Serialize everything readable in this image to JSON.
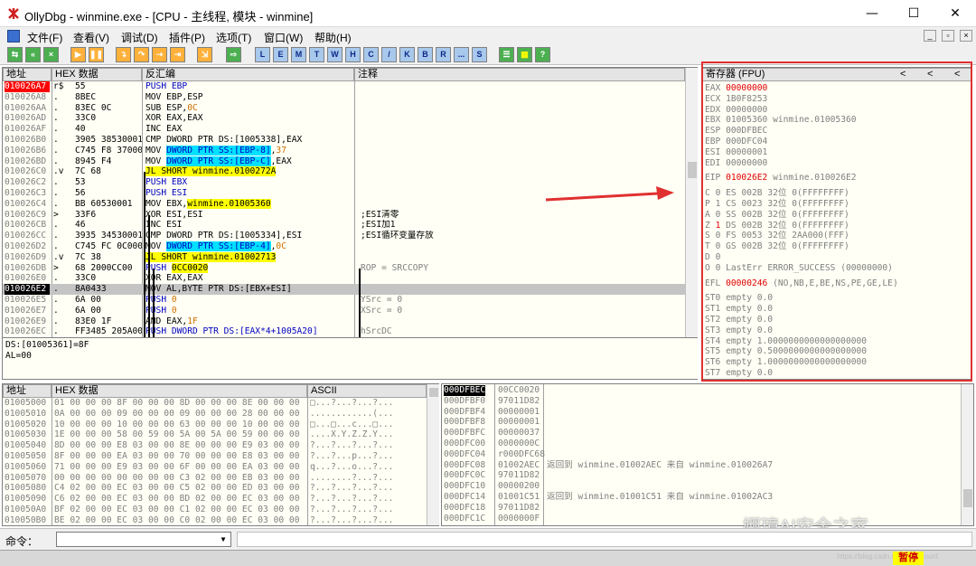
{
  "window": {
    "title": "OllyDbg - winmine.exe - [CPU - 主线程, 模块 - winmine]",
    "min": "—",
    "max": "☐",
    "close": "✕"
  },
  "menu": [
    "文件(F)",
    "查看(V)",
    "调试(D)",
    "插件(P)",
    "选项(T)",
    "窗口(W)",
    "帮助(H)"
  ],
  "toolbar_letters": [
    "L",
    "E",
    "M",
    "T",
    "W",
    "H",
    "C",
    "/",
    "K",
    "B",
    "R",
    "...",
    "S"
  ],
  "disasm": {
    "headers": [
      "地址",
      "HEX 数据",
      "反汇编",
      "注释"
    ],
    "rows": [
      {
        "addr": "010026A7",
        "mark": "r$",
        "hex": "55",
        "asm": [
          [
            "PUSH EBP",
            "blue"
          ]
        ],
        "cmt": "",
        "sel": "addr"
      },
      {
        "addr": "010026A8",
        "mark": ".",
        "hex": "8BEC",
        "asm": [
          [
            "MOV EBP,ESP",
            ""
          ]
        ],
        "cmt": ""
      },
      {
        "addr": "010026AA",
        "mark": ".",
        "hex": "83EC 0C",
        "asm": [
          [
            "SUB ESP,",
            ""
          ],
          [
            "0C",
            "orange"
          ]
        ],
        "cmt": ""
      },
      {
        "addr": "010026AD",
        "mark": ".",
        "hex": "33C0",
        "asm": [
          [
            "XOR EAX,EAX",
            ""
          ]
        ],
        "cmt": ""
      },
      {
        "addr": "010026AF",
        "mark": ".",
        "hex": "40",
        "asm": [
          [
            "INC EAX",
            ""
          ]
        ],
        "cmt": ""
      },
      {
        "addr": "010026B0",
        "mark": ".",
        "hex": "3905 38530001",
        "asm": [
          [
            "CMP DWORD PTR DS:[1005338],EAX",
            ""
          ]
        ],
        "cmt": ""
      },
      {
        "addr": "010026B6",
        "mark": ".",
        "hex": "C745 F8 370000",
        "asm": [
          [
            "MOV ",
            ""
          ],
          [
            "DWORD PTR SS:[EBP-8]",
            "hlcyan"
          ],
          [
            ",",
            ""
          ],
          [
            "37",
            "orange"
          ]
        ],
        "cmt": ""
      },
      {
        "addr": "010026BD",
        "mark": ".",
        "hex": "8945 F4",
        "asm": [
          [
            "MOV ",
            ""
          ],
          [
            "DWORD PTR SS:[EBP-C]",
            "hlcyan"
          ],
          [
            ",EAX",
            ""
          ]
        ],
        "cmt": ""
      },
      {
        "addr": "010026C0",
        "mark": ".v",
        "hex": "7C 68",
        "asm": [
          [
            "JL SHORT winmine.0100272A",
            "hlyel"
          ]
        ],
        "cmt": ""
      },
      {
        "addr": "010026C2",
        "mark": ".",
        "hex": "53",
        "asm": [
          [
            "PUSH EBX",
            "blue"
          ]
        ],
        "cmt": ""
      },
      {
        "addr": "010026C3",
        "mark": ".",
        "hex": "56",
        "asm": [
          [
            "PUSH ESI",
            "blue"
          ]
        ],
        "cmt": ""
      },
      {
        "addr": "010026C4",
        "mark": ".",
        "hex": "BB 60530001",
        "asm": [
          [
            "MOV EBX,",
            ""
          ],
          [
            "winmine.01005360",
            "hlyel"
          ]
        ],
        "cmt": ""
      },
      {
        "addr": "010026C9",
        "mark": ">",
        "hex": "33F6",
        "asm": [
          [
            "XOR ESI,ESI",
            ""
          ]
        ],
        "cmt": ";ESI清零"
      },
      {
        "addr": "010026CB",
        "mark": ".",
        "hex": "46",
        "asm": [
          [
            "INC ESI",
            ""
          ]
        ],
        "cmt": ";ESI加1"
      },
      {
        "addr": "010026CC",
        "mark": ".",
        "hex": "3935 34530001",
        "asm": [
          [
            "CMP DWORD PTR DS:[1005334],ESI",
            ""
          ]
        ],
        "cmt": ";ESI循环变量存放"
      },
      {
        "addr": "010026D2",
        "mark": ".",
        "hex": "C745 FC 0C0000",
        "asm": [
          [
            "MOV ",
            ""
          ],
          [
            "DWORD PTR SS:[EBP-4]",
            "hlcyan"
          ],
          [
            ",",
            ""
          ],
          [
            "0C",
            "orange"
          ]
        ],
        "cmt": ""
      },
      {
        "addr": "010026D9",
        "mark": ".v",
        "hex": "7C 38",
        "asm": [
          [
            "JL SHORT winmine.01002713",
            "hlyel"
          ]
        ],
        "cmt": ""
      },
      {
        "addr": "010026DB",
        "mark": ">",
        "hex": "68 2000CC00",
        "asm": [
          [
            "PUSH ",
            "blue"
          ],
          [
            "0CC0020",
            "hlyel"
          ]
        ],
        "cmt": "ROP = SRCCOPY"
      },
      {
        "addr": "010026E0",
        "mark": ".",
        "hex": "33C0",
        "asm": [
          [
            "XOR EAX,EAX",
            ""
          ]
        ],
        "cmt": ""
      },
      {
        "addr": "010026E2",
        "mark": ".",
        "hex": "8A0433",
        "asm": [
          [
            "MOV AL,BYTE PTR DS:[EBX+ESI]",
            ""
          ]
        ],
        "cmt": "",
        "sel": "row"
      },
      {
        "addr": "010026E5",
        "mark": ".",
        "hex": "6A 00",
        "asm": [
          [
            "PUSH ",
            "blue"
          ],
          [
            "0",
            "orange"
          ]
        ],
        "cmt": "YSrc = 0"
      },
      {
        "addr": "010026E7",
        "mark": ".",
        "hex": "6A 00",
        "asm": [
          [
            "PUSH ",
            "blue"
          ],
          [
            "0",
            "orange"
          ]
        ],
        "cmt": "XSrc = 0"
      },
      {
        "addr": "010026E9",
        "mark": ".",
        "hex": "83E0 1F",
        "asm": [
          [
            "AND EAX,",
            ""
          ],
          [
            "1F",
            "orange"
          ]
        ],
        "cmt": ""
      },
      {
        "addr": "010026EC",
        "mark": ".",
        "hex": "FF3485 205A000",
        "asm": [
          [
            "PUSH DWORD PTR DS:[EAX*4+1005A20]",
            "blue"
          ]
        ],
        "cmt": "hSrcDC"
      }
    ],
    "info": [
      "DS:[01005361]=8F",
      "AL=00"
    ]
  },
  "registers": {
    "header": "寄存器 (FPU)",
    "arrows": [
      "<",
      "<",
      "<"
    ],
    "gp": [
      [
        "EAX",
        "00000000",
        "",
        true
      ],
      [
        "ECX",
        "1B0F8253",
        "",
        false
      ],
      [
        "EDX",
        "00000000",
        "",
        false
      ],
      [
        "EBX",
        "01005360",
        "winmine.01005360",
        false
      ],
      [
        "ESP",
        "000DFBEC",
        "",
        false
      ],
      [
        "EBP",
        "000DFC04",
        "",
        false
      ],
      [
        "ESI",
        "00000001",
        "",
        false
      ],
      [
        "EDI",
        "00000000",
        "",
        false
      ]
    ],
    "eip": [
      "EIP",
      "010026E2",
      "winmine.010026E2"
    ],
    "flags": [
      [
        "C",
        "0",
        "ES",
        "002B",
        "32位",
        "0(FFFFFFFF)",
        false
      ],
      [
        "P",
        "1",
        "CS",
        "0023",
        "32位",
        "0(FFFFFFFF)",
        false
      ],
      [
        "A",
        "0",
        "SS",
        "002B",
        "32位",
        "0(FFFFFFFF)",
        false
      ],
      [
        "Z",
        "1",
        "DS",
        "002B",
        "32位",
        "0(FFFFFFFF)",
        true
      ],
      [
        "S",
        "0",
        "FS",
        "0053",
        "32位",
        "2AA000(FFF)",
        false
      ],
      [
        "T",
        "0",
        "GS",
        "002B",
        "32位",
        "0(FFFFFFFF)",
        false
      ],
      [
        "D",
        "0",
        "",
        "",
        "",
        "",
        false
      ],
      [
        "O",
        "0",
        "LastErr",
        "ERROR_SUCCESS",
        "(00000000)",
        "",
        false
      ]
    ],
    "efl": [
      "EFL",
      "00000246",
      "(NO,NB,E,BE,NS,PE,GE,LE)"
    ],
    "fpu": [
      "ST0 empty 0.0",
      "ST1 empty 0.0",
      "ST2 empty 0.0",
      "ST3 empty 0.0",
      "ST4 empty 1.0000000000000000000",
      "ST5 empty 0.5000000000000000000",
      "ST6 empty 1.0000000000000000000",
      "ST7 empty 0.0"
    ]
  },
  "dump": {
    "headers": [
      "地址",
      "HEX 数据",
      "ASCII"
    ],
    "rows": [
      [
        "01005000",
        "01 00 00 00 8F 00 00 00 8D 00 00 00 8E 00 00 00",
        "□...?...?...?..."
      ],
      [
        "01005010",
        "0A 00 00 00 09 00 00 00 09 00 00 00 28 00 00 00",
        "............(..."
      ],
      [
        "01005020",
        "10 00 00 00 10 00 00 00 63 00 00 00 10 00 00 00",
        "□...□...c...□..."
      ],
      [
        "01005030",
        "1E 00 00 00 58 00 59 00 5A 00 5A 00 59 00 00 00",
        "....X.Y.Z.Z.Y..."
      ],
      [
        "01005040",
        "8D 00 00 00 E8 03 00 00 8E 00 00 00 E9 03 00 00",
        "?...?...?...?..."
      ],
      [
        "01005050",
        "8F 00 00 00 EA 03 00 00 70 00 00 00 E8 03 00 00",
        "?...?...p...?..."
      ],
      [
        "01005060",
        "71 00 00 00 E9 03 00 00 6F 00 00 00 EA 03 00 00",
        "q...?...o...?..."
      ],
      [
        "01005070",
        "00 00 00 00 00 00 00 00 C3 02 00 00 EB 03 00 00",
        "........?...?..."
      ],
      [
        "01005080",
        "C4 02 00 00 EC 03 00 00 C5 02 00 00 ED 03 00 00",
        "?...?...?...?..."
      ],
      [
        "01005090",
        "C6 02 00 00 EC 03 00 00 BD 02 00 00 EC 03 00 00",
        "?...?...?...?..."
      ],
      [
        "010050A0",
        "BF 02 00 00 EC 03 00 00 C1 02 00 00 EC 03 00 00",
        "?...?...?...?..."
      ],
      [
        "010050B0",
        "BE 02 00 00 EC 03 00 00 C0 02 00 00 EC 03 00 00",
        "?...?...?...?..."
      ]
    ]
  },
  "stack": {
    "rows": [
      [
        "000DFBEC",
        "00CC0020",
        ""
      ],
      [
        "000DFBF0",
        "97011D82",
        ""
      ],
      [
        "000DFBF4",
        "00000001",
        ""
      ],
      [
        "000DFBF8",
        "00000001",
        ""
      ],
      [
        "000DFBFC",
        "00000037",
        ""
      ],
      [
        "000DFC00",
        "0000000C",
        ""
      ],
      [
        "000DFC04",
        "r000DFC68",
        ""
      ],
      [
        "000DFC08",
        "01002AEC",
        "返回到 winmine.01002AEC 来自 winmine.010026A7"
      ],
      [
        "000DFC0C",
        "97011D82",
        ""
      ],
      [
        "000DFC10",
        "00000200",
        ""
      ],
      [
        "000DFC14",
        "01001C51",
        "返回到 winmine.01001C51 来自 winmine.01002AC3"
      ],
      [
        "000DFC18",
        "97011D82",
        ""
      ],
      [
        "000DFC1C",
        "0000000F",
        ""
      ]
    ]
  },
  "command": {
    "label": "命令："
  },
  "status": {
    "state": "暂停"
  },
  "watermark": "娜璋AI安全之家",
  "url_watermark": "https://blog.csdn.net/Eastmount"
}
